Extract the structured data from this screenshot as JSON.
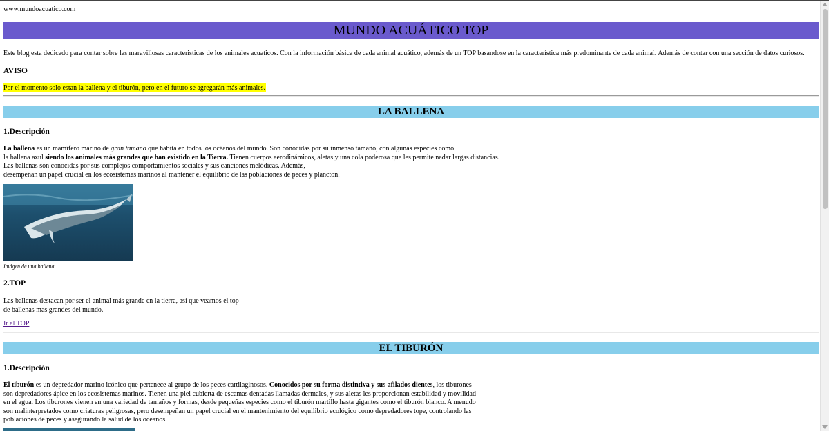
{
  "url": "www.mundoacuatico.com",
  "title": "MUNDO ACUÁTICO TOP",
  "intro": "Este blog esta dedicado para contar sobre las maravillosas caracteristicas de los animales acuaticos. Con la información básica de cada animal acuático, además de un TOP basandose en la característica más predominante de cada animal. Además de contar con una sección de datos curiosos.",
  "aviso": {
    "heading": "AVISO",
    "text": "Por el momento solo estan la ballena y el tiburón, pero en el futuro se agregarán más animales."
  },
  "ballena": {
    "heading": "LA BALLENA",
    "desc_heading": "1.Descripción",
    "p1_b1": "La ballena",
    "p1_t1": " es un mamífero marino de ",
    "p1_i1": "gran tamaño",
    "p1_t2": " que habita en todos los océanos del mundo. Son conocidas por su inmenso tamaño, con algunas especies como",
    "p2_t1": "la ballena azul ",
    "p2_b1": "siendo los animales más grandes que han existido en la Tierra.",
    "p2_t2": " Tienen cuerpos aerodinámicos, aletas y una cola poderosa que les permite nadar largas distancias.",
    "p3": "Las ballenas son conocidas por sus complejos comportamientos sociales y sus canciones melódicas. Además,",
    "p4": "desempeñan un papel crucial en los ecosistemas marinos al mantener el equilibrio de las poblaciones de peces y plancton.",
    "caption": "Imágen de una ballena",
    "top_heading": "2.TOP",
    "top_p1": "Las ballenas destacan por ser el animal más grande en la tierra, así que veamos el top",
    "top_p2": "de ballenas mas grandes del mundo.",
    "link": "Ir al TOP"
  },
  "tiburon": {
    "heading": "EL TIBURÓN",
    "desc_heading": "1.Descripción",
    "p1_b1": "El tiburón",
    "p1_t1": " es un depredador marino icónico que pertenece al grupo de los peces cartilaginosos. ",
    "p1_b2": "Conocidos por su forma distintiva y sus afilados dientes",
    "p1_t2": ", los tiburones",
    "p2": "son depredadores ápice en los ecosistemas marinos. Tienen una piel cubierta de escamas dentadas llamadas dermales, y sus aletas les proporcionan estabilidad y movilidad",
    "p3": "en el agua. Los tiburones vienen en una variedad de tamaños y formas, desde pequeñas especies como el tiburón martillo hasta gigantes como el tiburón blanco. A menudo",
    "p4": "son malinterpretados como criaturas peligrosas, pero desempeñan un papel crucial en el mantenimiento del equilibrio ecológico como depredadores tope, controlando las",
    "p5": "poblaciones de peces y asegurando la salud de los océanos."
  },
  "colors": {
    "title_bar": "#6a5acd",
    "section_bar": "#87ceeb",
    "aviso_highlight": "#ffff00",
    "link": "#551a8b"
  }
}
